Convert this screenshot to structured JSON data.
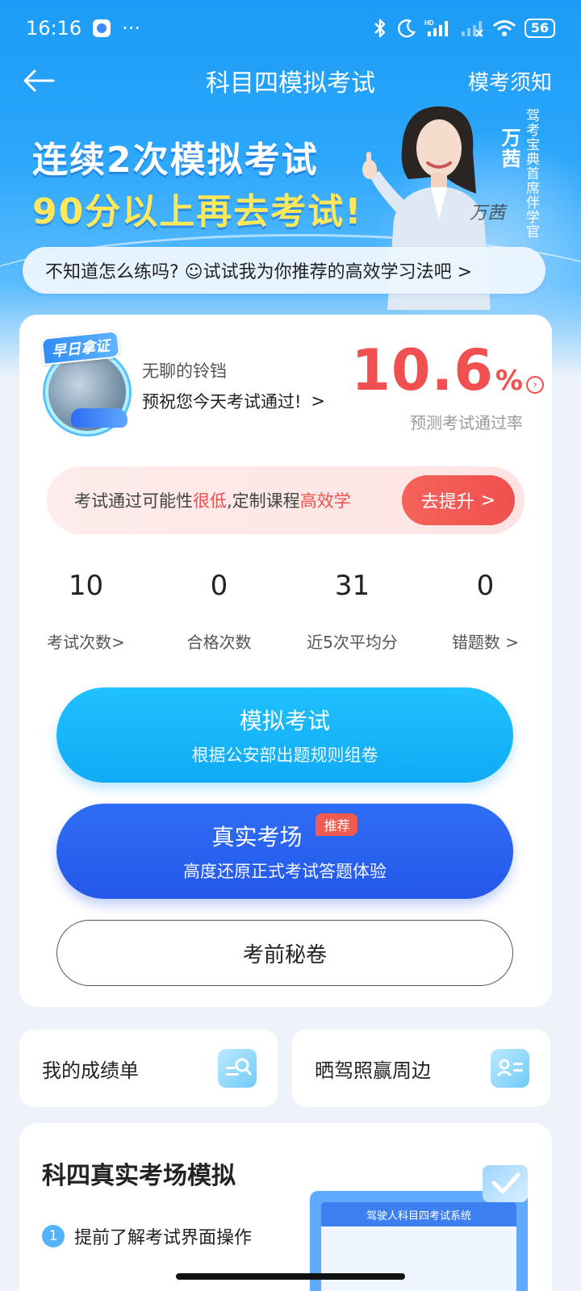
{
  "status_bar": {
    "time": "16:16",
    "more": "···",
    "battery": "56",
    "hd": "HD"
  },
  "nav": {
    "title": "科目四模拟考试",
    "right_link": "模考须知"
  },
  "promo": {
    "line1": "连续2次模拟考试",
    "line2": "90分以上再去考试!",
    "instructor_name": "万茜",
    "instructor_title": "驾考宝典首席伴学官",
    "signature": "万茜"
  },
  "tip": {
    "text": "不知道怎么练吗? ☺试试我为你推荐的高效学习法吧 >"
  },
  "profile": {
    "badge": "早日拿证",
    "username": "无聊的铃铛",
    "wish": "预祝您今天考试通过!",
    "wish_arrow": ">",
    "pass_rate_value": "10.6",
    "pass_rate_unit": "%",
    "pass_rate_label": "预测考试通过率"
  },
  "alert": {
    "part1": "考试通过可能性",
    "part2": "很低",
    "part3": ",定制课程",
    "part4": "高效学",
    "button": "去提升",
    "button_arrow": ">"
  },
  "stats": [
    {
      "value": "10",
      "label": "考试次数>"
    },
    {
      "value": "0",
      "label": "合格次数"
    },
    {
      "value": "31",
      "label": "近5次平均分"
    },
    {
      "value": "0",
      "label": "错题数 >"
    }
  ],
  "buttons": {
    "mock": {
      "title": "模拟考试",
      "subtitle": "根据公安部出题规则组卷"
    },
    "real": {
      "title": "真实考场",
      "tag": "推荐",
      "subtitle": "高度还原正式考试答题体验"
    },
    "secret": {
      "title": "考前秘卷"
    }
  },
  "shortcuts": [
    {
      "label": "我的成绩单"
    },
    {
      "label": "晒驾照赢周边"
    }
  ],
  "real_exam_section": {
    "title": "科四真实考场模拟",
    "step_number": "1",
    "step_text": "提前了解考试界面操作",
    "preview_header": "驾驶人科目四考试系统"
  },
  "colors": {
    "accent_blue": "#1c9cf6",
    "danger_red": "#f0504f",
    "mock_btn": "#10aaf5",
    "real_btn": "#2458ea",
    "promo_yellow": "#ffe95a"
  }
}
